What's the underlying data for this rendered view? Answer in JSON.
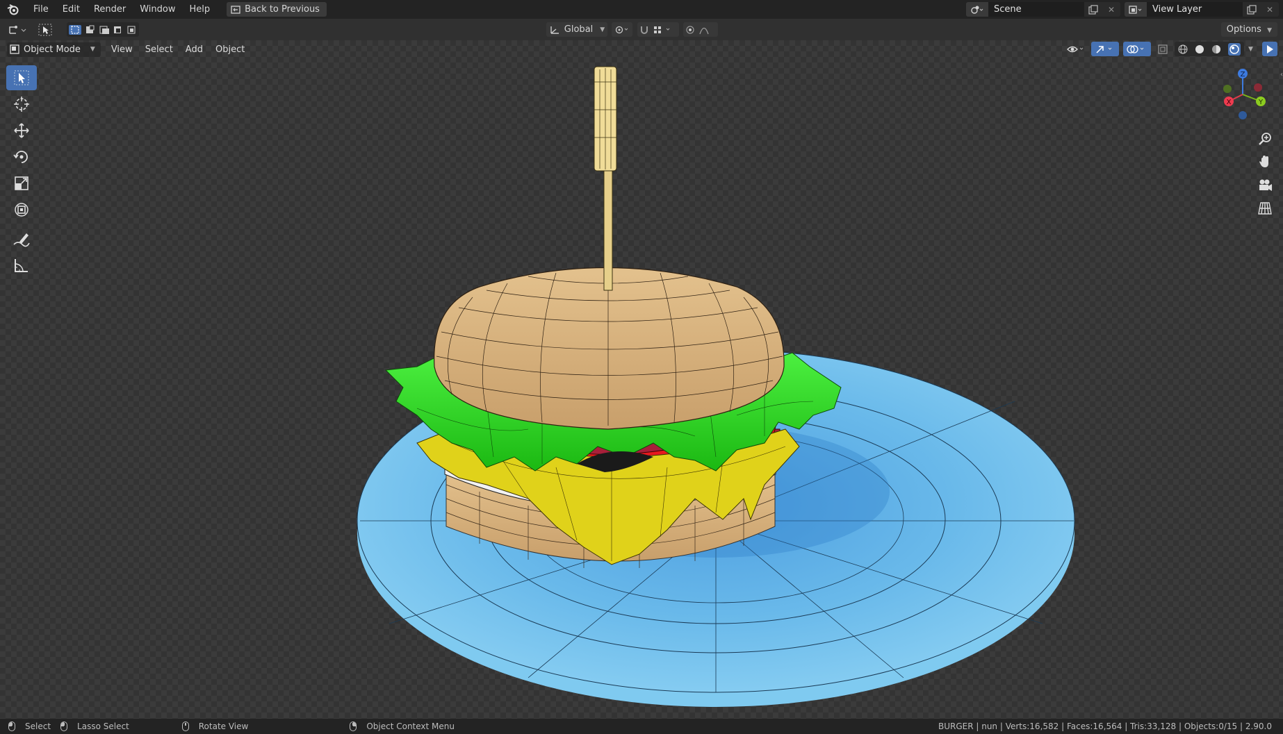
{
  "menubar": {
    "items": [
      "File",
      "Edit",
      "Render",
      "Window",
      "Help"
    ],
    "back_button": "Back to Previous",
    "scene_name": "Scene",
    "view_layer_name": "View Layer"
  },
  "tool_header": {
    "transform_orientation": "Global",
    "options_label": "Options"
  },
  "viewport_header": {
    "mode": "Object Mode",
    "menus": [
      "View",
      "Select",
      "Add",
      "Object"
    ]
  },
  "toolbar": {
    "tools": [
      "select-box",
      "cursor",
      "move",
      "rotate",
      "scale",
      "transform",
      "annotate",
      "measure"
    ],
    "active_tool": "select-box"
  },
  "gizmo": {
    "axes": [
      "X",
      "Y",
      "Z"
    ]
  },
  "status_bar": {
    "select": "Select",
    "lasso_select": "Lasso Select",
    "rotate_view": "Rotate View",
    "context_menu": "Object Context Menu",
    "stats": "BURGER | nun | Verts:16,582 | Faces:16,564 | Tris:33,128 | Objects:0/15 | 2.90.0"
  },
  "colors": {
    "plate": "#6ec3ec",
    "bun": "#d8b27c",
    "lettuce": "#24e21c",
    "tomato": "#e8191e",
    "cheese": "#e0d21a",
    "patty": "#a8203a",
    "onion": "#e838a8",
    "accent": "#4772b3"
  }
}
